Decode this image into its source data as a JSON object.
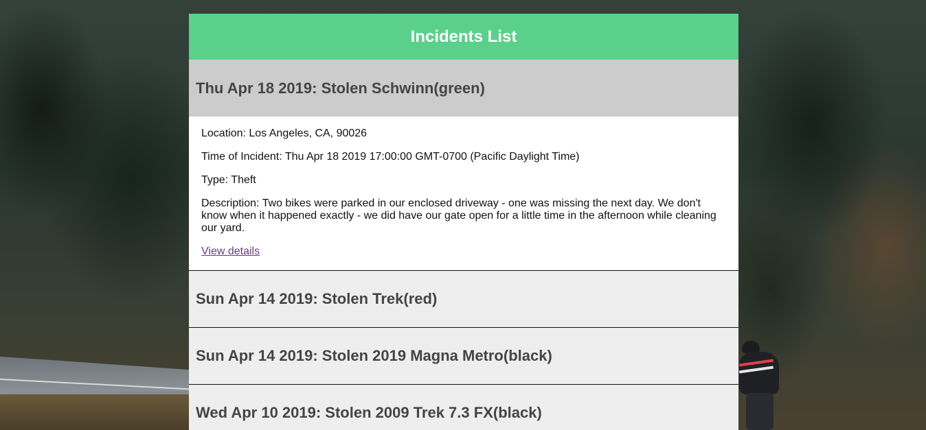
{
  "header": {
    "title": "Incidents List"
  },
  "incidents": [
    {
      "title": "Thu Apr 18 2019: Stolen Schwinn(green)",
      "expanded": true,
      "location": "Location: Los Angeles, CA, 90026",
      "time": "Time of Incident: Thu Apr 18 2019 17:00:00 GMT-0700 (Pacific Daylight Time)",
      "type": "Type: Theft",
      "description": "Description: Two bikes were parked in our enclosed driveway - one was missing the next day. We don't know when it happened exactly - we did have our gate open for a little time in the afternoon while cleaning our yard.",
      "link_label": "View details"
    },
    {
      "title": "Sun Apr 14 2019: Stolen Trek(red)",
      "expanded": false
    },
    {
      "title": "Sun Apr 14 2019: Stolen 2019 Magna Metro(black)",
      "expanded": false
    },
    {
      "title": "Wed Apr 10 2019: Stolen 2009 Trek 7.3 FX(black)",
      "expanded": false
    }
  ],
  "colors": {
    "header_bg": "#5ad08a",
    "open_header_bg": "#cccccc",
    "closed_header_bg": "#eeeeee",
    "link": "#663d7a"
  },
  "background": {
    "scene": "forest-road-cyclist-photo"
  }
}
